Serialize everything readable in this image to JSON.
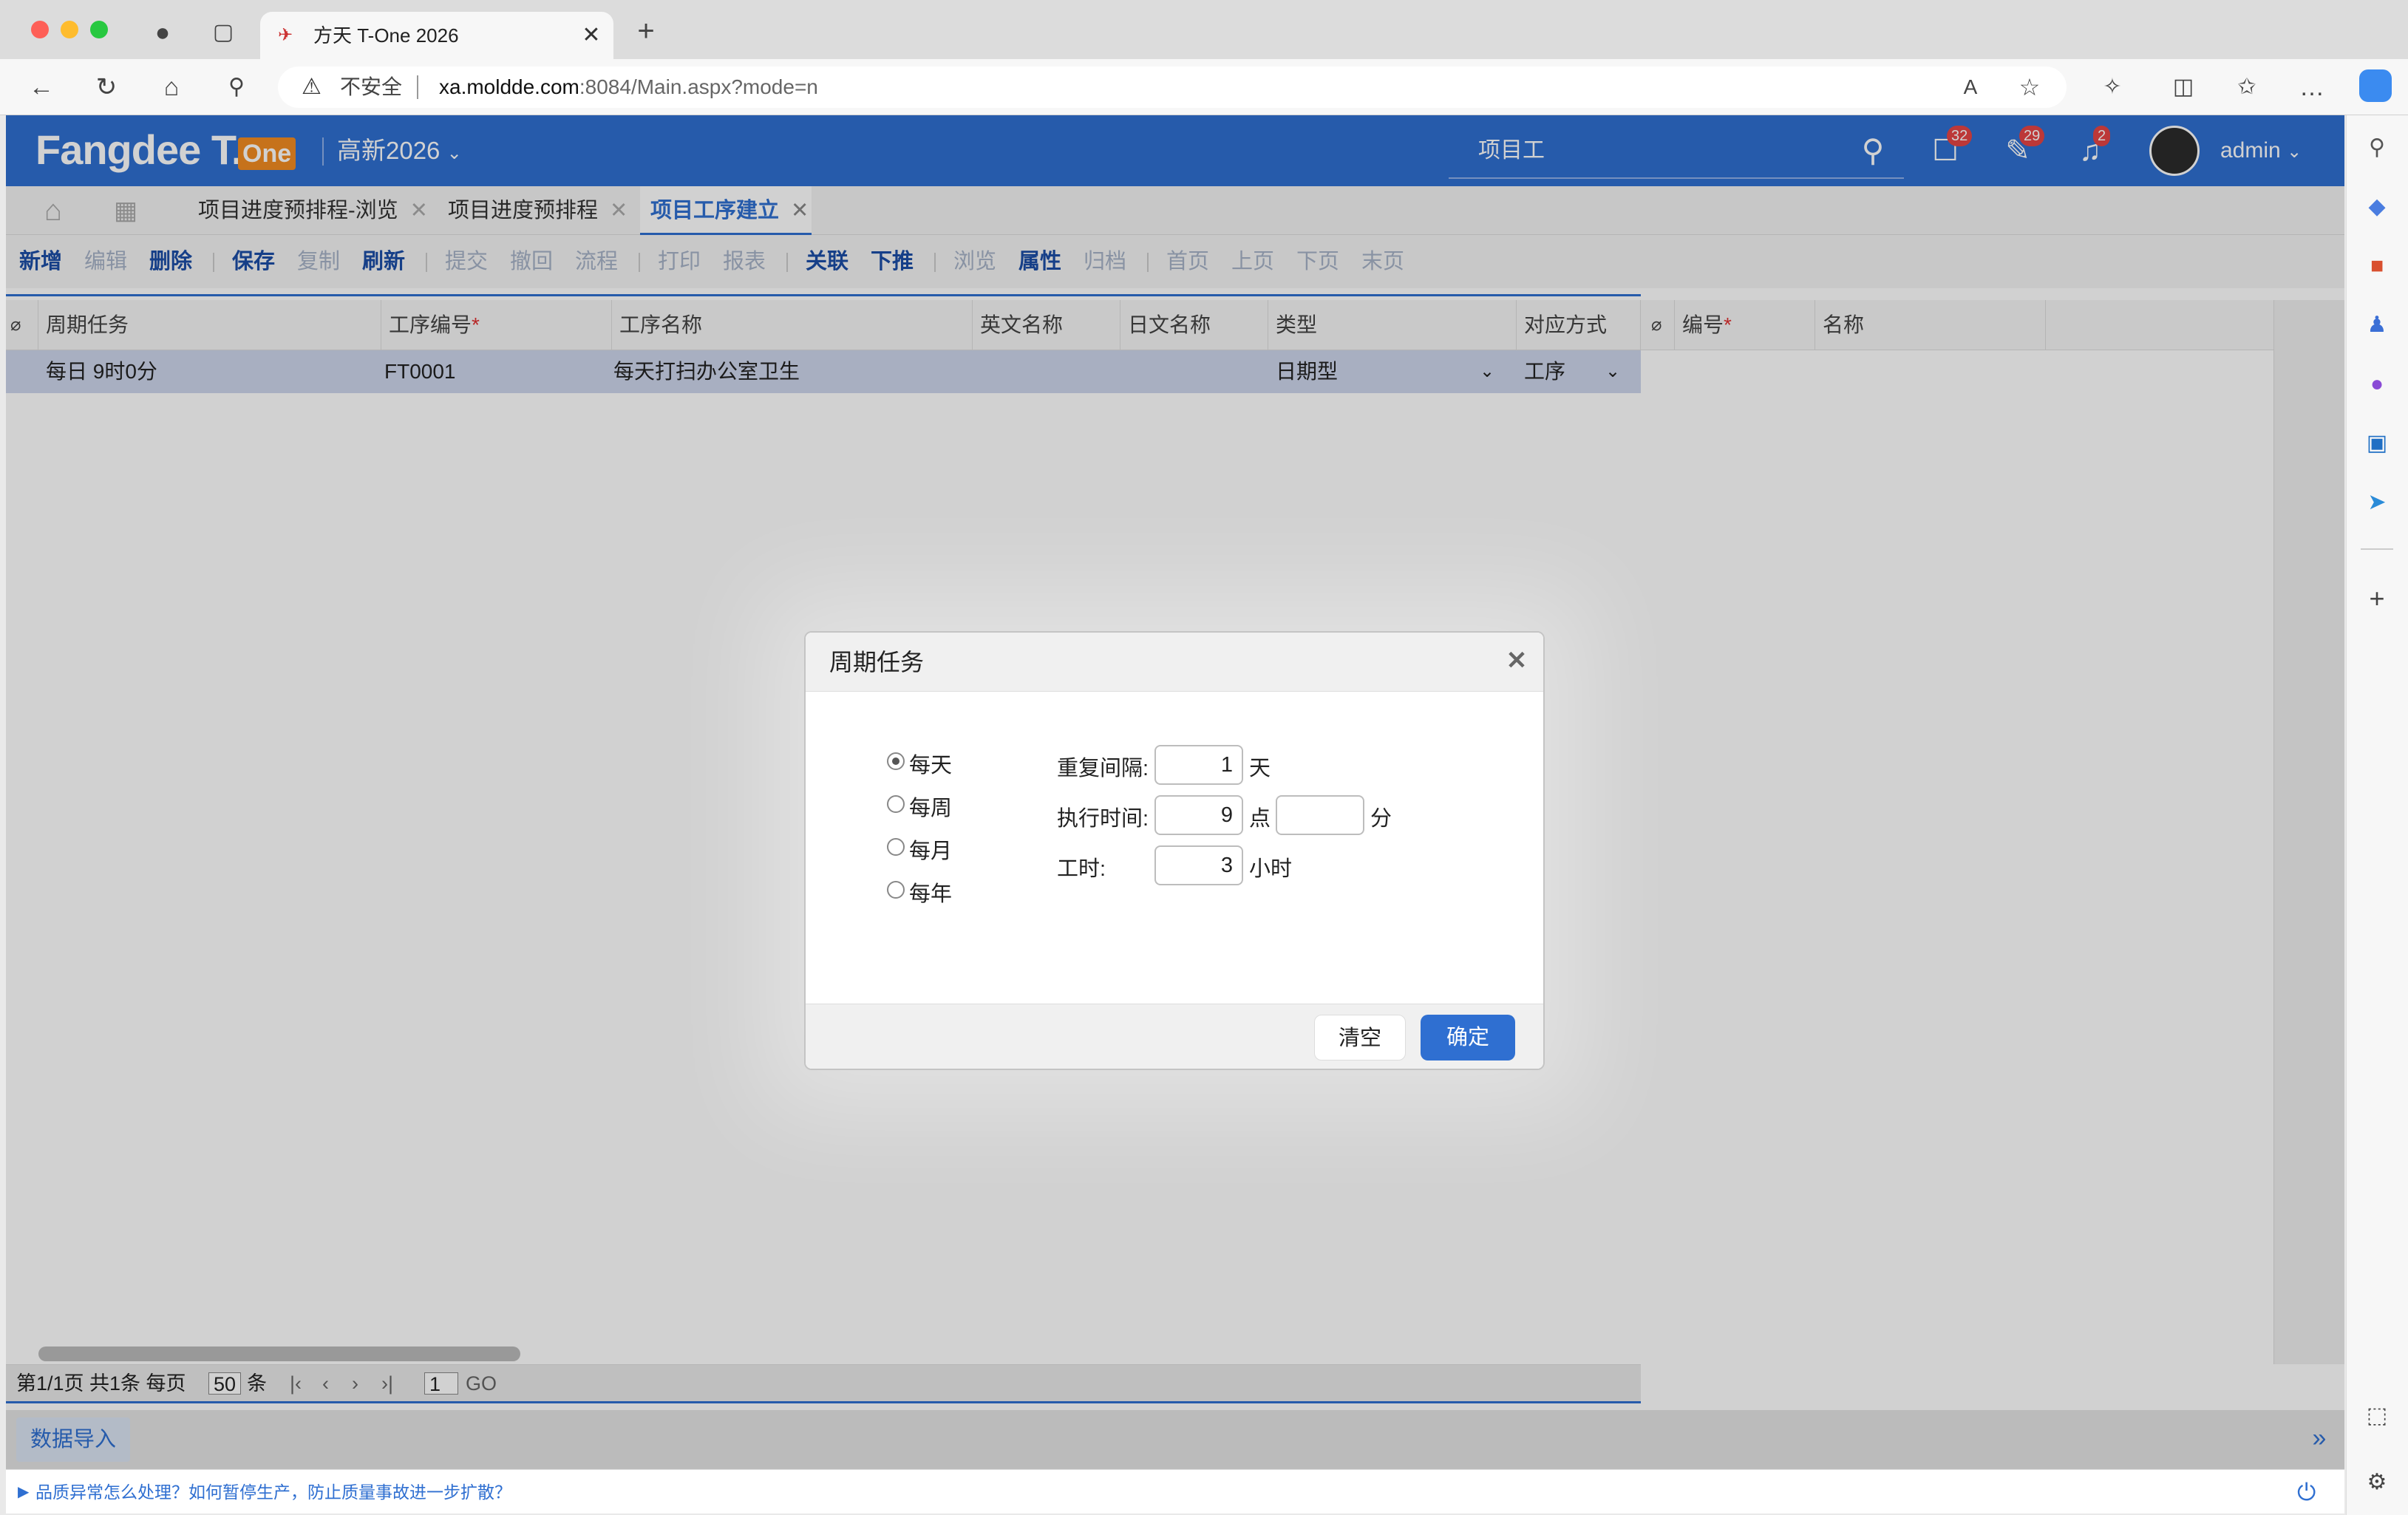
{
  "browser": {
    "tab_title": "方天 T-One 2026",
    "security_label": "不安全",
    "url_host": "xa.moldde.com",
    "url_rest": ":8084/Main.aspx?mode=n"
  },
  "app": {
    "logo_text": "Fangdee T.",
    "logo_badge": "One",
    "account_set": "高新2026",
    "search_value": "项目工",
    "badges": {
      "messages": "32",
      "tasks": "29",
      "notifications": "2"
    },
    "user": "admin"
  },
  "tabs": [
    {
      "label": "项目进度预排程-浏览"
    },
    {
      "label": "项目进度预排程"
    },
    {
      "label": "项目工序建立"
    }
  ],
  "toolbar": [
    "新增",
    "编辑",
    "删除",
    "保存",
    "复制",
    "刷新",
    "提交",
    "撤回",
    "流程",
    "打印",
    "报表",
    "关联",
    "下推",
    "浏览",
    "属性",
    "归档",
    "首页",
    "上页",
    "下页",
    "末页"
  ],
  "grid": {
    "columns": [
      "周期任务",
      "工序编号",
      "工序名称",
      "英文名称",
      "日文名称",
      "类型",
      "对应方式"
    ],
    "right_columns": [
      "编号",
      "名称"
    ],
    "row": {
      "cycle": "每日 9时0分",
      "code": "FT0001",
      "name": "每天打扫办公室卫生",
      "type": "日期型",
      "mode": "工序"
    },
    "pager": {
      "info": "第1/1页 共1条 每页",
      "page_size": "50",
      "unit": "条",
      "page_input": "1",
      "go": "GO"
    }
  },
  "import_button": "数据导入",
  "status_text": "品质异常怎么处理？如何暂停生产，防止质量事故进一步扩散？",
  "dialog": {
    "title": "周期任务",
    "options": [
      "每天",
      "每周",
      "每月",
      "每年"
    ],
    "repeat_label": "重复间隔:",
    "repeat_value": "1",
    "repeat_unit": "天",
    "time_label": "执行时间:",
    "hour_value": "9",
    "hour_unit": "点",
    "minute_value": "",
    "minute_unit": "分",
    "hours_label": "工时:",
    "hours_value": "3",
    "hours_unit": "小时",
    "clear_label": "清空",
    "ok_label": "确定"
  },
  "colors": {
    "brand": "#2f6fd1",
    "selected_row": "#cdd6ec"
  }
}
